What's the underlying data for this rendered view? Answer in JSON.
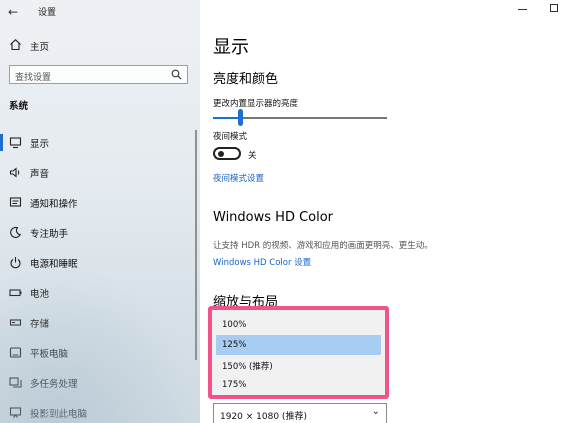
{
  "window": {
    "title": "设置"
  },
  "sidebar": {
    "home_label": "主页",
    "search_placeholder": "查找设置",
    "section_label": "系统",
    "items": [
      {
        "label": "显示",
        "icon": "monitor-icon",
        "selected": true
      },
      {
        "label": "声音",
        "icon": "speaker-icon",
        "selected": false
      },
      {
        "label": "通知和操作",
        "icon": "notification-icon",
        "selected": false
      },
      {
        "label": "专注助手",
        "icon": "moon-icon",
        "selected": false
      },
      {
        "label": "电源和睡眠",
        "icon": "power-icon",
        "selected": false
      },
      {
        "label": "电池",
        "icon": "battery-icon",
        "selected": false
      },
      {
        "label": "存储",
        "icon": "storage-icon",
        "selected": false
      },
      {
        "label": "平板电脑",
        "icon": "tablet-icon",
        "selected": false
      },
      {
        "label": "多任务处理",
        "icon": "multitask-icon",
        "selected": false
      },
      {
        "label": "投影到此电脑",
        "icon": "project-icon",
        "selected": false
      }
    ]
  },
  "main": {
    "page_title": "显示",
    "brightness_section": {
      "heading": "亮度和颜色",
      "slider_label": "更改内置显示器的亮度",
      "slider_value_pct": 16,
      "night_mode_label": "夜间模式",
      "night_mode_state": "关",
      "night_mode_link": "夜间模式设置"
    },
    "hdr_section": {
      "heading": "Windows HD Color",
      "description": "让支持 HDR 的视频、游戏和应用的画面更明亮、更生动。",
      "link": "Windows HD Color 设置"
    },
    "scale_section": {
      "heading": "缩放与布局",
      "scale_options": [
        "100%",
        "125%",
        "150% (推荐)",
        "175%"
      ],
      "selected_scale": "125%",
      "resolution_value": "1920 × 1080 (推荐)"
    }
  },
  "colors": {
    "accent": "#1a6fd0",
    "link": "#1a64c8",
    "highlight_border": "#f0528c",
    "selected_option": "#a8cdf2"
  }
}
